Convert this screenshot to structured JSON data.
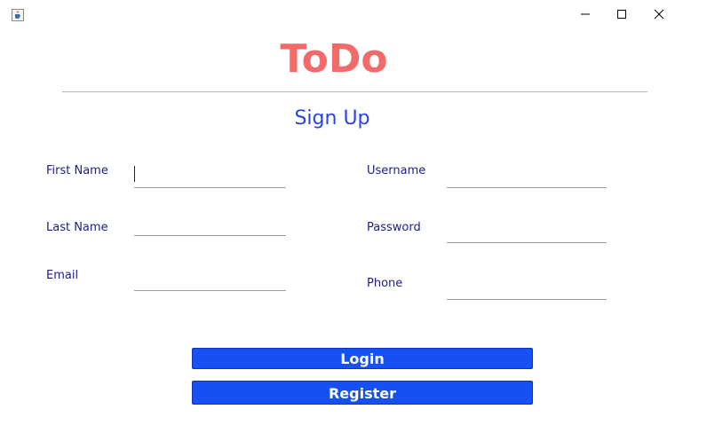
{
  "window": {
    "icon": "java-coffee-cup-icon"
  },
  "app": {
    "title": "ToDo",
    "subtitle": "Sign Up"
  },
  "form": {
    "first_name_label": "First Name",
    "last_name_label": "Last Name",
    "email_label": "Email",
    "username_label": "Username",
    "password_label": "Password",
    "phone_label": "Phone",
    "first_name_value": "",
    "last_name_value": "",
    "email_value": "",
    "username_value": "",
    "password_value": "",
    "phone_value": ""
  },
  "buttons": {
    "login_label": "Login",
    "register_label": "Register"
  },
  "colors": {
    "title": "#f36a6a",
    "subtitle": "#2a43e8",
    "label": "#1a1e8c",
    "button": "#1650f3"
  }
}
